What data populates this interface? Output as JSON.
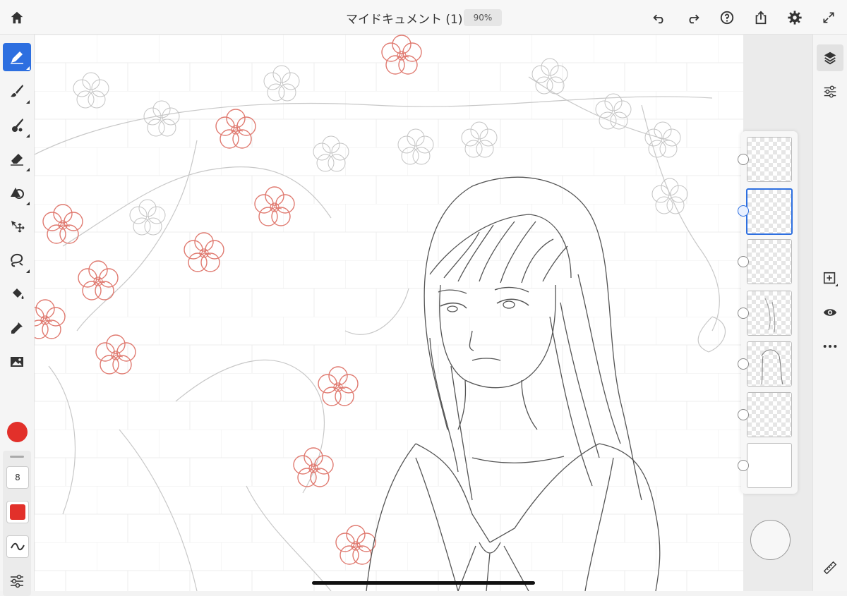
{
  "header": {
    "title": "マイドキュメント (1)",
    "zoom": "90%",
    "icons": [
      "home-icon",
      "undo-icon",
      "redo-icon",
      "help-icon",
      "share-icon",
      "settings-icon",
      "fullscreen-icon"
    ]
  },
  "left_toolbar": {
    "tools": [
      "pencil-tool",
      "brush-tool",
      "blend-brush-tool",
      "eraser-tool",
      "shape-tool",
      "move-tool",
      "lasso-tool",
      "fill-tool",
      "eyedropper-tool",
      "image-tool"
    ],
    "active_tool": "pencil-tool",
    "brush_size": "8",
    "current_color": "#e2302a"
  },
  "layers": {
    "count": 7,
    "selected_index": 1
  },
  "right_toolbar": {
    "icons": [
      "layers-icon",
      "adjustments-icon",
      "add-layer-icon",
      "visibility-icon",
      "more-icon",
      "ruler-icon"
    ]
  },
  "colors": {
    "accent": "#2d6fe0",
    "sketch_red": "#e2302a"
  }
}
